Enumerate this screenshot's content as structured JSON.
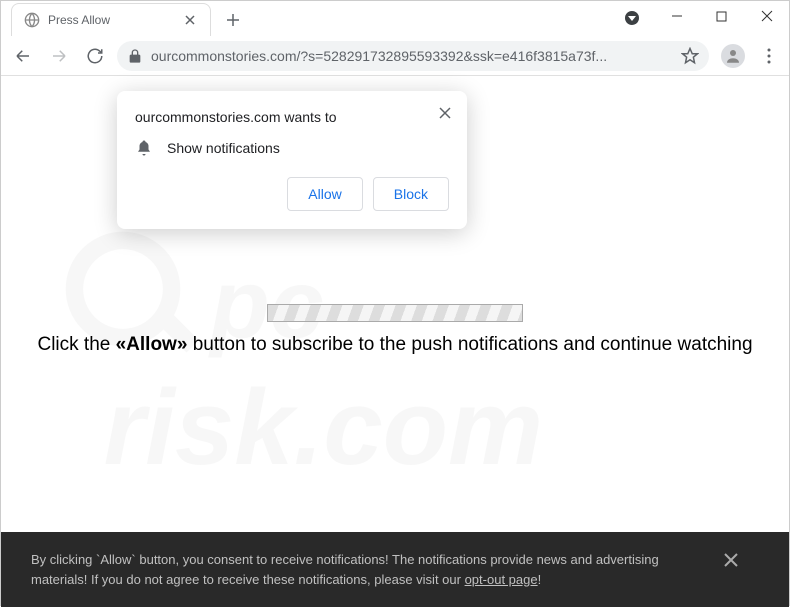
{
  "tab": {
    "title": "Press Allow"
  },
  "address": {
    "url": "ourcommonstories.com/?s=528291732895593392&ssk=e416f3815a73f..."
  },
  "popup": {
    "title": "ourcommonstories.com wants to",
    "label": "Show notifications",
    "allow": "Allow",
    "block": "Block"
  },
  "mainText": {
    "p1": "Click the ",
    "strong": "«Allow»",
    "p2": " button to subscribe to the push notifications and continue watching"
  },
  "banner": {
    "line1": "By clicking `Allow` button, you consent to receive notifications! The notifications provide news and advertising",
    "line2a": "materials! If you do not agree to receive these notifications, please visit our ",
    "link": "opt-out page",
    "line2b": "!"
  }
}
